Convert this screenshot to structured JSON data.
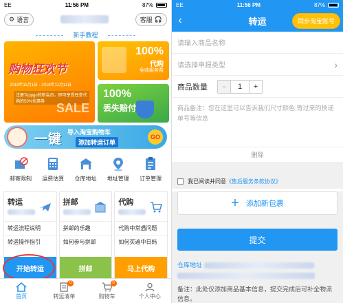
{
  "status_bar": {
    "left": {
      "carrier": "EE",
      "wifi_icon": "wifi-icon"
    },
    "time": "11:56 PM",
    "battery": "87%"
  },
  "left_screen": {
    "header": {
      "language_label": "语言",
      "service_label": "客服"
    },
    "tutorial_title": "新手教程",
    "banners": {
      "main_title": "购物狂欢节",
      "main_date": "2018年11月1日 - 2018年11月11日",
      "main_line": "注册Toppgo的新会员，即可享受任意代购的50%优惠券",
      "main_sale": "SALE",
      "small1_big": "100%",
      "small1_line1": "代购",
      "small1_line2": "免收服务费",
      "small2_big": "100%",
      "small2_line1": "丢失赔付"
    },
    "import_banner": {
      "big": "一键",
      "line1": "导入淘宝购物车",
      "line2": "添加转运订单",
      "go": "GO"
    },
    "menu": [
      {
        "label": "邮寄限制",
        "icon": "prohibited-box-icon"
      },
      {
        "label": "运费估算",
        "icon": "calculator-icon"
      },
      {
        "label": "仓库地址",
        "icon": "warehouse-icon"
      },
      {
        "label": "地址管理",
        "icon": "location-pin-icon"
      },
      {
        "label": "订单管理",
        "icon": "clipboard-icon"
      }
    ],
    "cards": [
      {
        "title": "转运",
        "rows": [
          "转运流程说明",
          "转运操作指引"
        ],
        "button": "开始转运",
        "icon": "airplane-icon"
      },
      {
        "title": "拼邮",
        "rows": [
          "拼邮的乐趣",
          "如何参与拼邮"
        ],
        "button": "拼邮",
        "icon": "boxes-icon"
      },
      {
        "title": "代购",
        "rows": [
          "代购中常遇问题",
          "如何买遍中日韩"
        ],
        "button": "马上代购",
        "icon": "cart-icon"
      }
    ],
    "tabbar": [
      {
        "label": "首页",
        "icon": "home-icon",
        "badge": ""
      },
      {
        "label": "转运清单",
        "icon": "list-icon",
        "badge": "0"
      },
      {
        "label": "购物车",
        "icon": "cart-icon",
        "badge": "0"
      },
      {
        "label": "个人中心",
        "icon": "person-icon",
        "badge": ""
      }
    ]
  },
  "right_screen": {
    "nav": {
      "title": "转运",
      "sync_button": "同步淘宝账号",
      "back_icon": "chevron-left-icon"
    },
    "product_name_placeholder": "请输入商品名称",
    "declare_type_placeholder": "请选择申报类型",
    "quantity": {
      "label": "商品数量",
      "minus": "-",
      "value": "1",
      "plus": "+"
    },
    "note_placeholder": "商品备注：您在这里可以告诉我们尺寸颜色,寄过来的快递单号等信息",
    "delete_label": "删除",
    "agree": {
      "text": "我已阅读并同意",
      "link": "《售后服务条款协议》"
    },
    "add_package": {
      "plus": "+",
      "label": "添加新包裹"
    },
    "submit": "提交",
    "warehouse_label": "仓库地址",
    "remark": "备注：此处仅添加商品基本信息，提交完成后可补全物流信息。"
  }
}
